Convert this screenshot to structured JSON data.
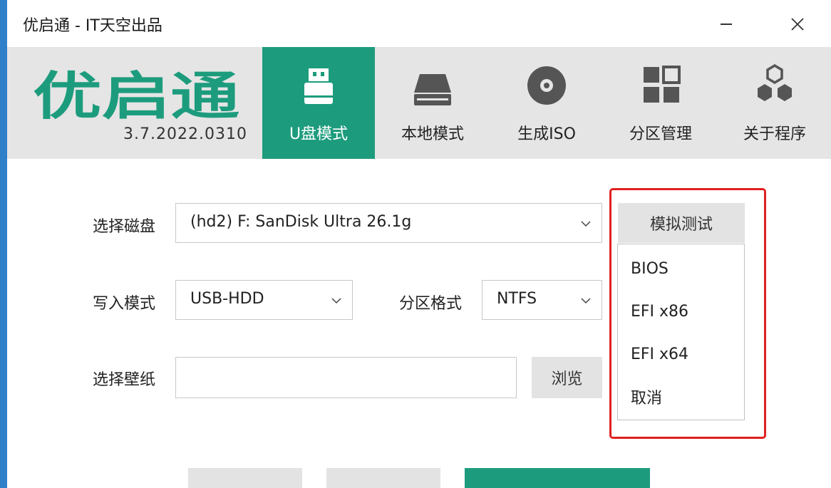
{
  "app": {
    "title": "优启通 - IT天空出品",
    "logo_text": "优启通",
    "version": "3.7.2022.0310"
  },
  "nav": [
    {
      "label": "U盘模式",
      "icon": "usb-drive-icon",
      "active": true
    },
    {
      "label": "本地模式",
      "icon": "hard-drive-icon",
      "active": false
    },
    {
      "label": "生成ISO",
      "icon": "disc-icon",
      "active": false
    },
    {
      "label": "分区管理",
      "icon": "partition-grid-icon",
      "active": false
    },
    {
      "label": "关于程序",
      "icon": "hexagons-icon",
      "active": false
    }
  ],
  "form": {
    "disk_label": "选择磁盘",
    "disk_value": "(hd2) F: SanDisk Ultra 26.1g",
    "write_mode_label": "写入模式",
    "write_mode_value": "USB-HDD",
    "partition_format_label": "分区格式",
    "partition_format_value": "NTFS",
    "wallpaper_label": "选择壁纸",
    "wallpaper_value": "",
    "browse_label": "浏览"
  },
  "simulate": {
    "button_label": "模拟测试",
    "menu": [
      "BIOS",
      "EFI x86",
      "EFI x64",
      "取消"
    ]
  },
  "colors": {
    "accent": "#1d9c7d",
    "highlight_border": "#e02020",
    "header_bg": "#e5e5e5"
  }
}
